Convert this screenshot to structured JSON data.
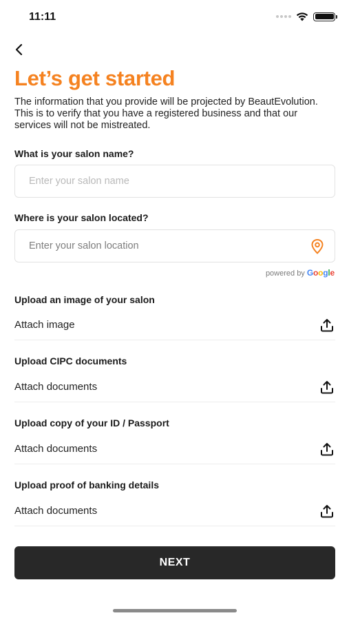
{
  "status_bar": {
    "time": "11:11",
    "battery_level": 1.0
  },
  "header": {
    "back_icon": "chevron-left-icon",
    "title": "Let’s get started",
    "intro": "The information that you provide will be projected by BeautEvolution. This is to verify that you have a registered business and that our services will not be mistreated."
  },
  "form": {
    "salon_name": {
      "label": "What is your salon name?",
      "placeholder": "Enter your salon name",
      "value": ""
    },
    "salon_location": {
      "label": "Where is your salon located?",
      "placeholder": "Enter your salon location",
      "value": "",
      "icon": "location-pin-icon"
    },
    "powered_by": {
      "text": "powered by",
      "brand": "Google"
    },
    "uploads": [
      {
        "label": "Upload an image of your salon",
        "action": "Attach image",
        "icon": "upload-icon"
      },
      {
        "label": "Upload CIPC documents",
        "action": "Attach documents",
        "icon": "upload-icon"
      },
      {
        "label": "Upload copy of your ID / Passport",
        "action": "Attach documents",
        "icon": "upload-icon"
      },
      {
        "label": "Upload proof of banking details",
        "action": "Attach documents",
        "icon": "upload-icon"
      }
    ]
  },
  "footer": {
    "next_label": "NEXT"
  },
  "colors": {
    "accent": "#f58220",
    "button_bg": "#282828",
    "google_blue": "#4285F4",
    "google_red": "#EA4335",
    "google_yellow": "#FBBC05",
    "google_green": "#34A853"
  }
}
